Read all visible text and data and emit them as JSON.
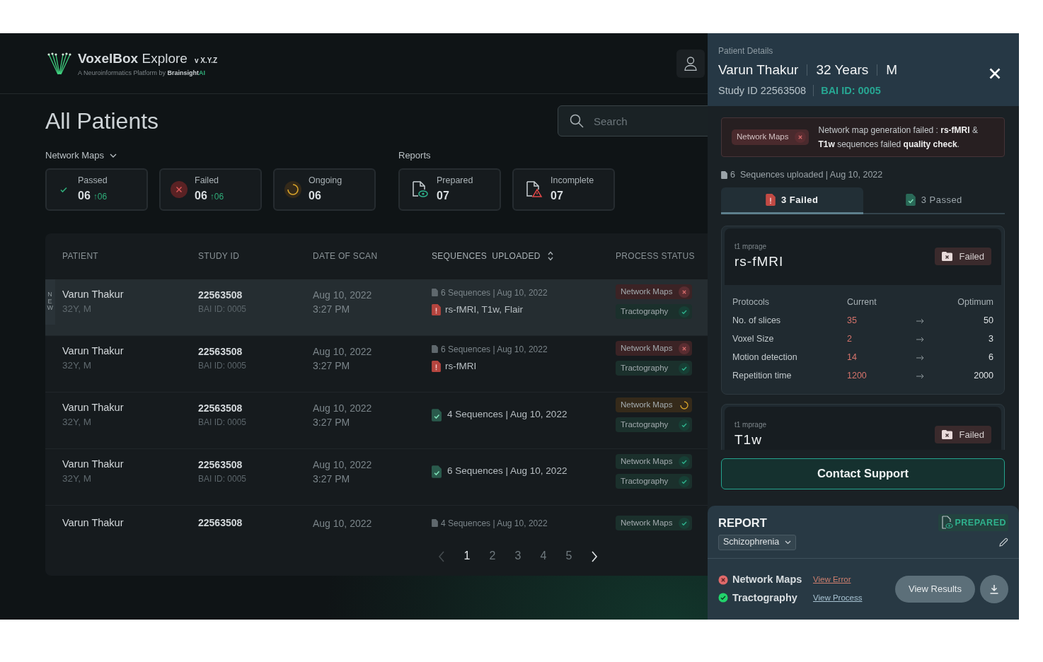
{
  "app": {
    "name": "VoxelBox",
    "name_suffix": "Explore",
    "version": "v X.Y.Z",
    "tagline": "A Neuroinformatics Platform by",
    "brand": "Brainsight",
    "brand_suffix": "AI"
  },
  "page_title": "All Patients",
  "search": {
    "placeholder": "Search"
  },
  "network_maps": {
    "label": "Network Maps",
    "stats": [
      {
        "kind": "passed",
        "label": "Passed",
        "count": "06",
        "delta": "↑06"
      },
      {
        "kind": "failed",
        "label": "Failed",
        "count": "06",
        "delta": "↑06"
      },
      {
        "kind": "ongoing",
        "label": "Ongoing",
        "count": "06"
      }
    ]
  },
  "reports": {
    "label": "Reports",
    "stats": [
      {
        "kind": "prepared",
        "label": "Prepared",
        "count": "07"
      },
      {
        "kind": "incomplete",
        "label": "Incomplete",
        "count": "07"
      }
    ]
  },
  "table": {
    "columns": [
      {
        "label": "PATIENT",
        "sortable": false
      },
      {
        "label": "STUDY ID",
        "sortable": false
      },
      {
        "label": "DATE OF SCAN",
        "sortable": false
      },
      {
        "label": "SEQUENCES  UPLOADED",
        "sortable": true
      },
      {
        "label": "PROCESS STATUS",
        "sortable": false
      }
    ],
    "rows": [
      {
        "selected": true,
        "new": true,
        "new_label": "NEW",
        "name": "Varun Thakur",
        "info": "32Y, M",
        "study_id": "22563508",
        "bai_id": "BAI ID: 0005",
        "date": "Aug 10, 2022",
        "time": "3:27 PM",
        "sequences": {
          "kind": "failed",
          "summary": "6 Sequences | Aug 10, 2022",
          "failed": "rs-fMRI, T1w, Flair"
        },
        "statuses": [
          {
            "label": "Network Maps",
            "kind": "failed"
          },
          {
            "label": "Tractography",
            "kind": "passed"
          }
        ]
      },
      {
        "selected": false,
        "new": false,
        "name": "Varun Thakur",
        "info": "32Y, M",
        "study_id": "22563508",
        "bai_id": "BAI ID: 0005",
        "date": "Aug 10, 2022",
        "time": "3:27 PM",
        "sequences": {
          "kind": "failed",
          "summary": "6 Sequences | Aug 10, 2022",
          "failed": "rs-fMRI"
        },
        "statuses": [
          {
            "label": "Network Maps",
            "kind": "failed"
          },
          {
            "label": "Tractography",
            "kind": "passed"
          }
        ]
      },
      {
        "selected": false,
        "new": false,
        "name": "Varun Thakur",
        "info": "32Y, M",
        "study_id": "22563508",
        "bai_id": "BAI ID: 0005",
        "date": "Aug 10, 2022",
        "time": "3:27 PM",
        "sequences": {
          "kind": "passed",
          "summary": "4 Sequences | Aug 10, 2022"
        },
        "statuses": [
          {
            "label": "Network Maps",
            "kind": "ongoing"
          },
          {
            "label": "Tractography",
            "kind": "passed"
          }
        ]
      },
      {
        "selected": false,
        "new": false,
        "name": "Varun Thakur",
        "info": "32Y, M",
        "study_id": "22563508",
        "bai_id": "BAI ID: 0005",
        "date": "Aug 10, 2022",
        "time": "3:27 PM",
        "sequences": {
          "kind": "passed",
          "summary": "6 Sequences | Aug 10, 2022"
        },
        "statuses": [
          {
            "label": "Network Maps",
            "kind": "passed"
          },
          {
            "label": "Tractography",
            "kind": "passed"
          }
        ]
      },
      {
        "selected": false,
        "new": false,
        "name": "Varun Thakur",
        "study_id": "22563508",
        "date": "Aug 10, 2022",
        "sequences": {
          "kind": "summary",
          "summary": "4 Sequences | Aug 10, 2022"
        },
        "statuses": [
          {
            "label": "Network Maps",
            "kind": "passed"
          }
        ]
      }
    ]
  },
  "pagination": {
    "prev_disabled": true,
    "pages": [
      {
        "label": "1",
        "selected": true
      },
      {
        "label": "2",
        "selected": false
      },
      {
        "label": "3",
        "selected": false
      },
      {
        "label": "4",
        "selected": false
      },
      {
        "label": "5",
        "selected": false
      }
    ]
  },
  "details": {
    "caption": "Patient Details",
    "name": "Varun Thakur",
    "age": "32 Years",
    "sex": "M",
    "study_id": "Study ID 22563508",
    "bai_id": "BAI ID: 0005",
    "alert": {
      "tag": "Network Maps",
      "message": "Network map generation failed : **rs-fMRI** & **T1w** sequences failed **quality check**."
    },
    "sequences_summary": "6  Sequences uploaded | Aug 10, 2022",
    "tabs": [
      {
        "label": "3 Failed",
        "kind": "failed",
        "selected": true
      },
      {
        "label": "3 Passed",
        "kind": "passed",
        "selected": false
      }
    ],
    "sequence_cards": [
      {
        "subtitle": "t1 mprage",
        "name": "rs-fMRI",
        "status": "Failed",
        "expanded": true,
        "protocol_header": [
          "Protocols",
          "Current",
          "Optimum"
        ],
        "protocols": [
          {
            "name": "No. of slices",
            "current": "35",
            "optimum": "50"
          },
          {
            "name": "Voxel Size",
            "current": "2",
            "optimum": "3"
          },
          {
            "name": "Motion detection",
            "current": "14",
            "optimum": "6"
          },
          {
            "name": "Repetition time",
            "current": "1200",
            "optimum": "2000"
          }
        ]
      },
      {
        "subtitle": "t1 mprage",
        "name": "T1w",
        "status": "Failed",
        "expanded": false
      }
    ],
    "contact_button": "Contact Support"
  },
  "report": {
    "title": "REPORT",
    "status": "PREPARED",
    "condition": "Schizophrenia",
    "processes": [
      {
        "name": "Network Maps",
        "kind": "failed",
        "link": "View Error"
      },
      {
        "name": "Tractography",
        "kind": "passed",
        "link": "View Process"
      }
    ],
    "view_button": "View Results"
  }
}
